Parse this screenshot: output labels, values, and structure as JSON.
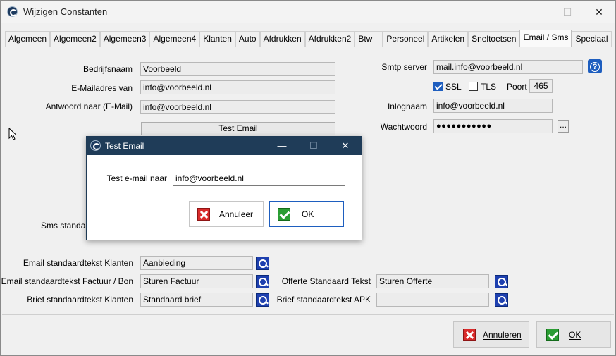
{
  "window": {
    "title": "Wijzigen Constanten",
    "controls": {
      "minimize": "—",
      "maximize": "☐",
      "close": "✕"
    }
  },
  "tabs": [
    {
      "label": "Algemeen"
    },
    {
      "label": "Algemeen2"
    },
    {
      "label": "Algemeen3"
    },
    {
      "label": "Algemeen4"
    },
    {
      "label": "Klanten"
    },
    {
      "label": "Auto"
    },
    {
      "label": "Afdrukken"
    },
    {
      "label": "Afdrukken2"
    },
    {
      "label": "Btw"
    },
    {
      "label": "Personeel"
    },
    {
      "label": "Artikelen"
    },
    {
      "label": "Sneltoetsen"
    },
    {
      "label": "Email / Sms",
      "active": true
    },
    {
      "label": "Speciaal"
    }
  ],
  "form": {
    "bedrijfsnaam": {
      "label": "Bedrijfsnaam",
      "value": "Voorbeeld"
    },
    "emailadres": {
      "label": "E-Mailadres van",
      "value": "info@voorbeeld.nl"
    },
    "antwoord": {
      "label": "Antwoord naar (E-Mail)",
      "value": "info@voorbeeld.nl"
    },
    "test_email_button": "Test Email",
    "smtp": {
      "label": "Smtp server",
      "value": "mail.info@voorbeeld.nl",
      "help": "?"
    },
    "ssl": {
      "label": "SSL",
      "checked": true
    },
    "tls": {
      "label": "TLS",
      "checked": false
    },
    "poort": {
      "label": "Poort",
      "value": "465"
    },
    "inlognaam": {
      "label": "Inlognaam",
      "value": "info@voorbeeld.nl"
    },
    "wachtwoord": {
      "label": "Wachtwoord",
      "value": "●●●●●●●●●●●",
      "more": "..."
    },
    "sms_label": "Sms standaar",
    "email_klanten": {
      "label": "Email standaardtekst Klanten",
      "value": "Aanbieding"
    },
    "email_factuur": {
      "label": "Email standaardtekst Factuur / Bon",
      "value": "Sturen Factuur"
    },
    "brief_klanten": {
      "label": "Brief standaardtekst Klanten",
      "value": "Standaard brief"
    },
    "offerte": {
      "label": "Offerte Standaard Tekst",
      "value": "Sturen Offerte"
    },
    "brief_apk": {
      "label": "Brief standaardtekst APK",
      "value": ""
    }
  },
  "footer": {
    "cancel": "Annuleren",
    "ok": "OK"
  },
  "dialog": {
    "title": "Test Email",
    "controls": {
      "minimize": "—",
      "maximize": "☐",
      "close": "✕"
    },
    "field_label": "Test e-mail naar",
    "field_value": "info@voorbeeld.nl",
    "cancel": "Annuleer",
    "ok": "OK"
  },
  "colors": {
    "dialog_titlebar": "#1f3c58",
    "search_button": "#1e40af",
    "cancel_icon": "#d92b2b",
    "ok_icon": "#2a9d33"
  }
}
